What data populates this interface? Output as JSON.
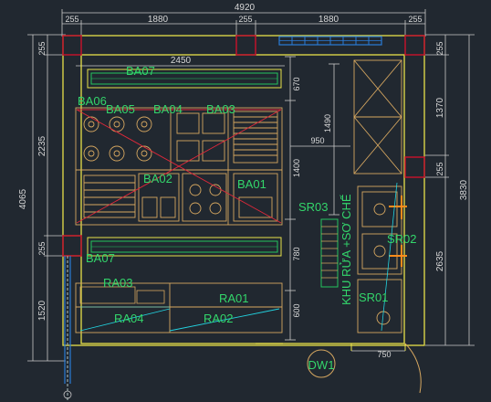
{
  "colors": {
    "background": "#212830",
    "wall": "#e8e24a",
    "dimension": "#c9c9c9",
    "equipment": "#d6a760",
    "label": "#33d66b",
    "column": "#c0122a",
    "window": "#2a7bd6",
    "diagonal": "#e0283a",
    "counter_line": "#22d3e0",
    "orange": "#ff8c1a"
  },
  "dimensions": {
    "top_total": "4920",
    "top_segments": [
      "255",
      "1880",
      "255",
      "1880",
      "255"
    ],
    "inner_width": "2450",
    "left_total": "4065",
    "left_segments": [
      "255",
      "2235",
      "255",
      "1520"
    ],
    "right_segments": [
      "255",
      "1370",
      "255",
      "2635"
    ],
    "right_total": "3830",
    "mid_vertical": [
      "670",
      "1400",
      "780",
      "600"
    ],
    "vertical_1490": "1490",
    "horizontal_950": "950",
    "bottom_750": "750"
  },
  "labels": {
    "ba07_top": "BA07",
    "ba06": "BA06",
    "ba05": "BA05",
    "ba04": "BA04",
    "ba03": "BA03",
    "ba02": "BA02",
    "ba01": "BA01",
    "ba07_bottom": "BA07",
    "sr03": "SR03",
    "sr02": "SR02",
    "sr01": "SR01",
    "ra03": "RA03",
    "ra04": "RA04",
    "ra01": "RA01",
    "ra02": "RA02",
    "zone": "KHU RỬA +SƠ CHẾ",
    "dw1": "DW1"
  }
}
